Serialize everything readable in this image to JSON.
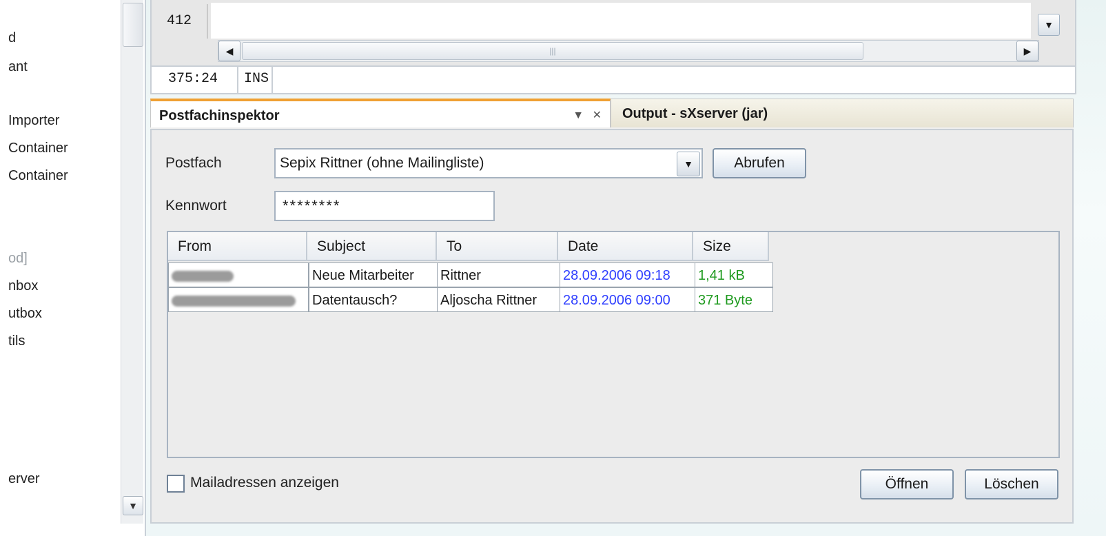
{
  "left_tree": {
    "items": [
      {
        "label": "d",
        "gray": false
      },
      {
        "label": "ant",
        "gray": false
      },
      {
        "label": "Importer",
        "gray": false
      },
      {
        "label": "Container",
        "gray": false
      },
      {
        "label": "Container",
        "gray": false
      },
      {
        "label": "od]",
        "gray": true
      },
      {
        "label": "nbox",
        "gray": false
      },
      {
        "label": "utbox",
        "gray": false
      },
      {
        "label": "tils",
        "gray": false
      },
      {
        "label": "erver",
        "gray": false
      }
    ]
  },
  "editor": {
    "line_number": "412",
    "cursor_position": "375:24",
    "insert_mode": "INS"
  },
  "tabs": {
    "active": "Postfachinspektor",
    "inactive": "Output - sXserver (jar)"
  },
  "form": {
    "postfach_label": "Postfach",
    "postfach_value": "Sepix Rittner (ohne Mailingliste)",
    "abrufen_label": "Abrufen",
    "kennwort_label": "Kennwort",
    "kennwort_value": "********"
  },
  "table": {
    "headers": [
      "From",
      "Subject",
      "To",
      "Date",
      "Size"
    ],
    "rows": [
      {
        "from": "",
        "subject": "Neue Mitarbeiter",
        "to": "Rittner",
        "date": "28.09.2006 09:18",
        "size": "1,41 kB"
      },
      {
        "from": "",
        "subject": "Datentausch?",
        "to": "Aljoscha Rittner",
        "date": "28.09.2006 09:00",
        "size": "371 Byte"
      }
    ]
  },
  "footer": {
    "checkbox_label": "Mailadressen anzeigen",
    "open_label": "Öffnen",
    "delete_label": "Löschen"
  },
  "colors": {
    "date_color": "#2f3fff",
    "size_color": "#1f9a1f",
    "tab_accent": "#f0a033"
  }
}
